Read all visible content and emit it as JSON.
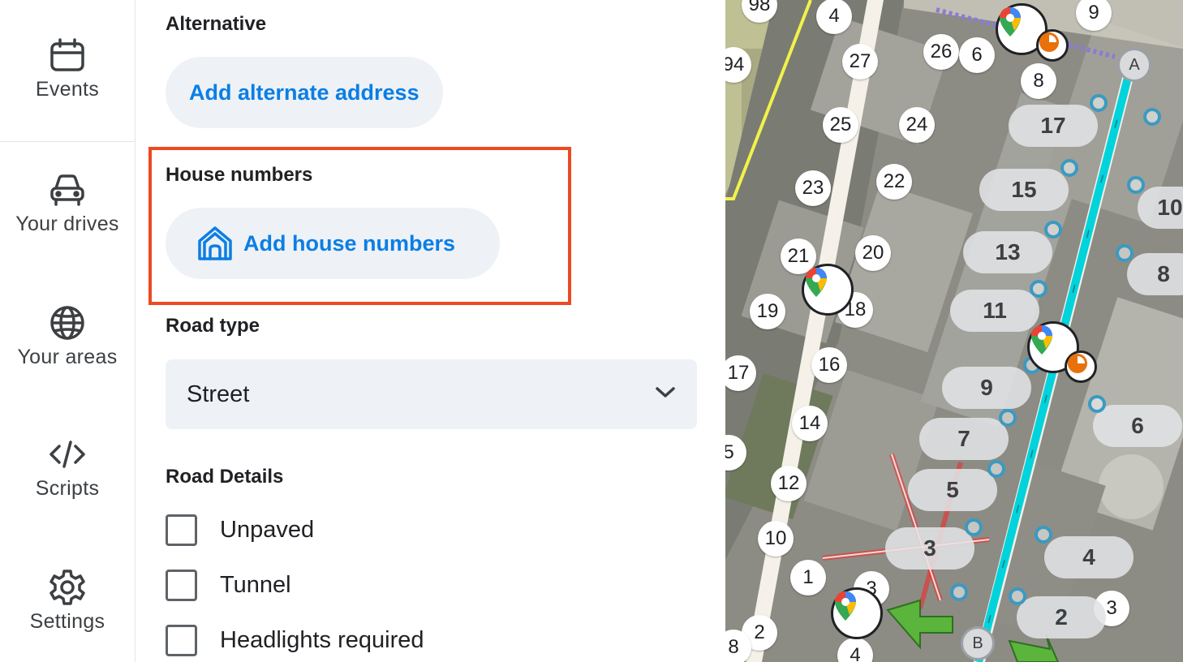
{
  "nav": {
    "items": [
      {
        "label": "Events",
        "icon": "calendar-icon"
      },
      {
        "label": "Your drives",
        "icon": "car-icon"
      },
      {
        "label": "Your areas",
        "icon": "globe-icon"
      },
      {
        "label": "Scripts",
        "icon": "code-icon"
      },
      {
        "label": "Settings",
        "icon": "gear-icon"
      }
    ]
  },
  "panel": {
    "alternative": {
      "title": "Alternative",
      "button_label": "Add alternate address"
    },
    "house_numbers": {
      "title": "House numbers",
      "button_label": "Add house numbers",
      "button_icon": "house-icon"
    },
    "road_type": {
      "title": "Road type",
      "selected": "Street"
    },
    "road_details": {
      "title": "Road Details",
      "options": [
        {
          "label": "Unpaved",
          "checked": false
        },
        {
          "label": "Tunnel",
          "checked": false
        },
        {
          "label": "Headlights required",
          "checked": false
        }
      ]
    }
  },
  "map": {
    "house_numbers": [
      "98",
      "4",
      "9",
      "94",
      "27",
      "26",
      "6",
      "8",
      "25",
      "24",
      "23",
      "22",
      "21",
      "20",
      "19",
      "18",
      "17",
      "16",
      "14",
      "12",
      "10",
      "1",
      "3",
      "2",
      "8",
      "4",
      "5",
      "3"
    ],
    "street_numbers": [
      "17",
      "15",
      "13",
      "11",
      "9",
      "7",
      "5",
      "3",
      "4",
      "2",
      "10",
      "8",
      "6"
    ],
    "segment_endpoints": [
      "A",
      "B"
    ],
    "colors": {
      "selected_segment": "#00d3dc",
      "highlight_border": "#ec4a22",
      "accent": "#0b7ee5"
    }
  }
}
